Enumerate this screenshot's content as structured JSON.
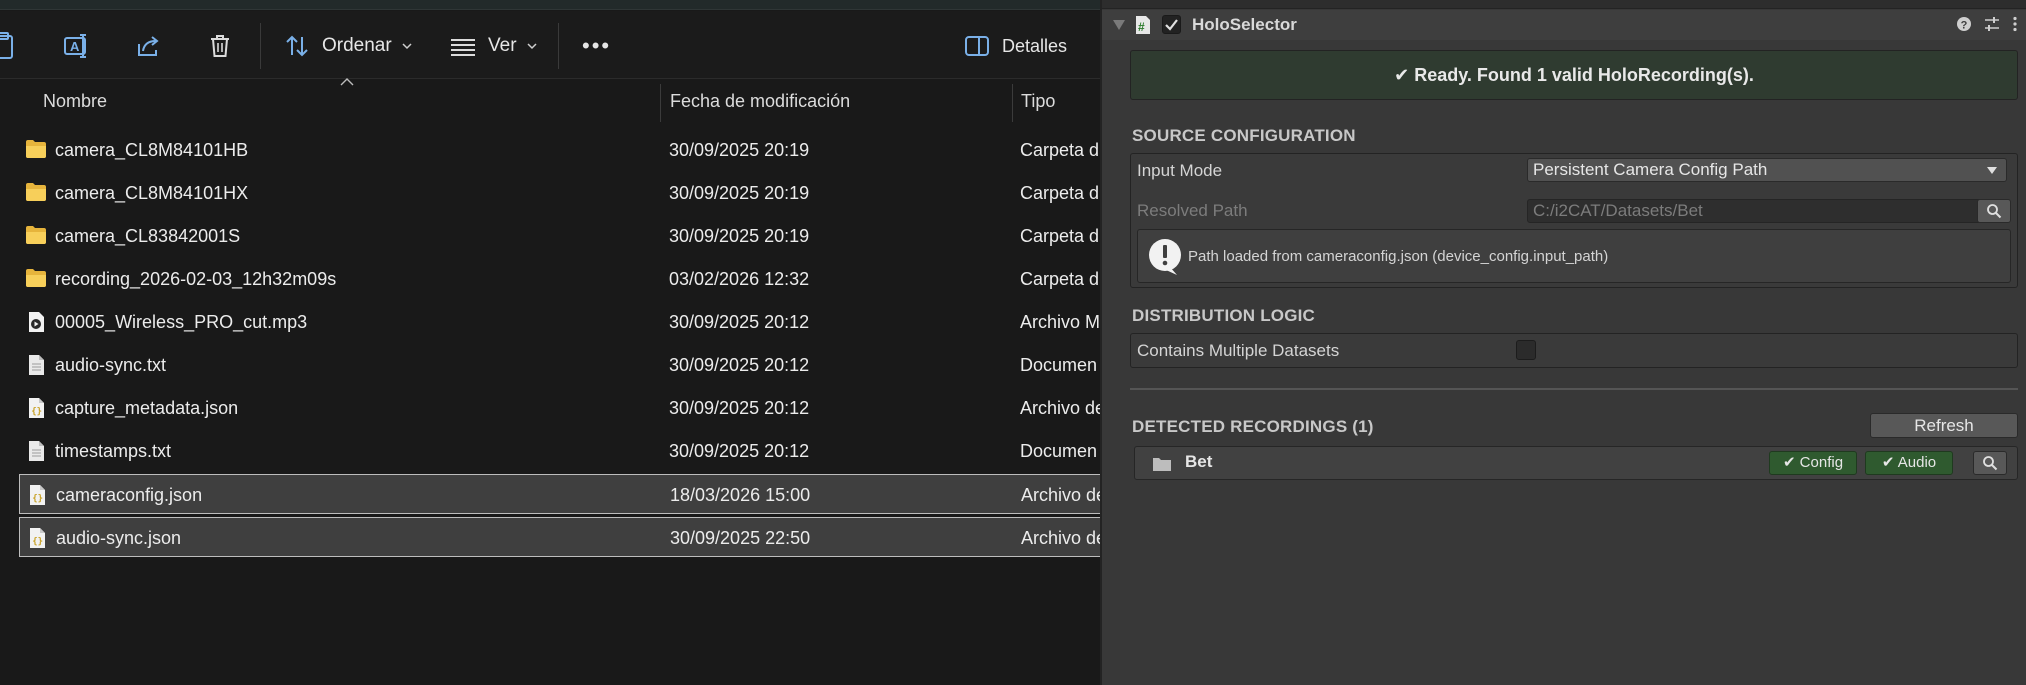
{
  "explorer": {
    "toolbar": {
      "sort_label": "Ordenar",
      "view_label": "Ver",
      "more_label": "•••",
      "details_label": "Detalles"
    },
    "columns": {
      "name": "Nombre",
      "date": "Fecha de modificación",
      "type": "Tipo"
    },
    "files": [
      {
        "icon": "folder-icon",
        "name": "camera_CL8M84101HB",
        "date": "30/09/2025 20:19",
        "type": "Carpeta d",
        "selected": false
      },
      {
        "icon": "folder-icon",
        "name": "camera_CL8M84101HX",
        "date": "30/09/2025 20:19",
        "type": "Carpeta d",
        "selected": false
      },
      {
        "icon": "folder-icon",
        "name": "camera_CL83842001S",
        "date": "30/09/2025 20:19",
        "type": "Carpeta d",
        "selected": false
      },
      {
        "icon": "folder-icon",
        "name": "recording_2026-02-03_12h32m09s",
        "date": "03/02/2026 12:32",
        "type": "Carpeta d",
        "selected": false
      },
      {
        "icon": "audio-file-icon",
        "name": "00005_Wireless_PRO_cut.mp3",
        "date": "30/09/2025 20:12",
        "type": "Archivo M",
        "selected": false
      },
      {
        "icon": "text-file-icon",
        "name": "audio-sync.txt",
        "date": "30/09/2025 20:12",
        "type": "Documen",
        "selected": false
      },
      {
        "icon": "json-file-icon",
        "name": "capture_metadata.json",
        "date": "30/09/2025 20:12",
        "type": "Archivo de",
        "selected": false
      },
      {
        "icon": "text-file-icon",
        "name": "timestamps.txt",
        "date": "30/09/2025 20:12",
        "type": "Documen",
        "selected": false
      },
      {
        "icon": "json-file-icon",
        "name": "cameraconfig.json",
        "date": "18/03/2026 15:00",
        "type": "Archivo de",
        "selected": true
      },
      {
        "icon": "json-file-icon",
        "name": "audio-sync.json",
        "date": "30/09/2025 22:50",
        "type": "Archivo de",
        "selected": true
      }
    ]
  },
  "inspector": {
    "component_title": "HoloSelector",
    "status_message": "✔ Ready. Found 1 valid HoloRecording(s).",
    "source_config": {
      "section_title": "SOURCE CONFIGURATION",
      "input_mode_label": "Input Mode",
      "input_mode_value": "Persistent Camera Config Path",
      "resolved_path_label": "Resolved Path",
      "resolved_path_value": "C:/i2CAT/Datasets/Bet",
      "info_message": "Path loaded from cameraconfig.json (device_config.input_path)"
    },
    "distribution": {
      "section_title": "DISTRIBUTION LOGIC",
      "multiple_datasets_label": "Contains Multiple Datasets"
    },
    "recordings": {
      "section_title": "DETECTED RECORDINGS (1)",
      "refresh_label": "Refresh",
      "items": [
        {
          "name": "Bet",
          "config_badge": "✔ Config",
          "audio_badge": "✔ Audio"
        }
      ]
    },
    "colors": {
      "status_bg": "#2f3b30",
      "badge_bg": "#2f5a2f",
      "panel_bg": "#383838",
      "explorer_bg": "#191919",
      "selection_bg": "#3f3f3f"
    }
  }
}
